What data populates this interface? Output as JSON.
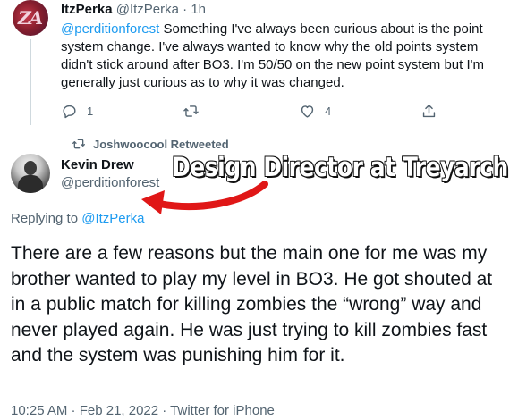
{
  "reply_tweet": {
    "author_name": "ItzPerka",
    "author_handle": "@ItzPerka",
    "separator": "·",
    "time_ago": "1h",
    "mention": "@perditionforest",
    "body_text": " Something I've always been curious about is the point system change. I've always wanted to know why the old points system didn't stick around after BO3. I'm 50/50 on the new point system but I'm generally just curious as to why it was changed.",
    "reply_count": "1",
    "retweet_count": "",
    "like_count": "4",
    "icons": [
      "reply-icon",
      "retweet-icon",
      "like-icon",
      "share-icon"
    ]
  },
  "retweet_notice": {
    "text": "Joshwoocool Retweeted",
    "icon": "retweet-icon"
  },
  "main_tweet": {
    "author_name": "Kevin Drew",
    "author_handle": "@perditionforest",
    "replying_prefix": "Replying to ",
    "replying_to": "@ItzPerka",
    "body_text": "There are a few reasons but the main one for me was my brother wanted to play my level in BO3. He got shouted at in a public match for killing zombies the “wrong” way and never played again. He was just trying to kill zombies fast and the system was punishing him for it.",
    "timestamp": "10:25 AM · Feb 21, 2022 · Twitter for iPhone"
  },
  "overlay": {
    "caption": "Design Director at Treyarch",
    "arrow_color": "#e01717"
  },
  "colors": {
    "link": "#1d9bf0",
    "secondary_text": "#536471",
    "primary_text": "#0f1419"
  }
}
